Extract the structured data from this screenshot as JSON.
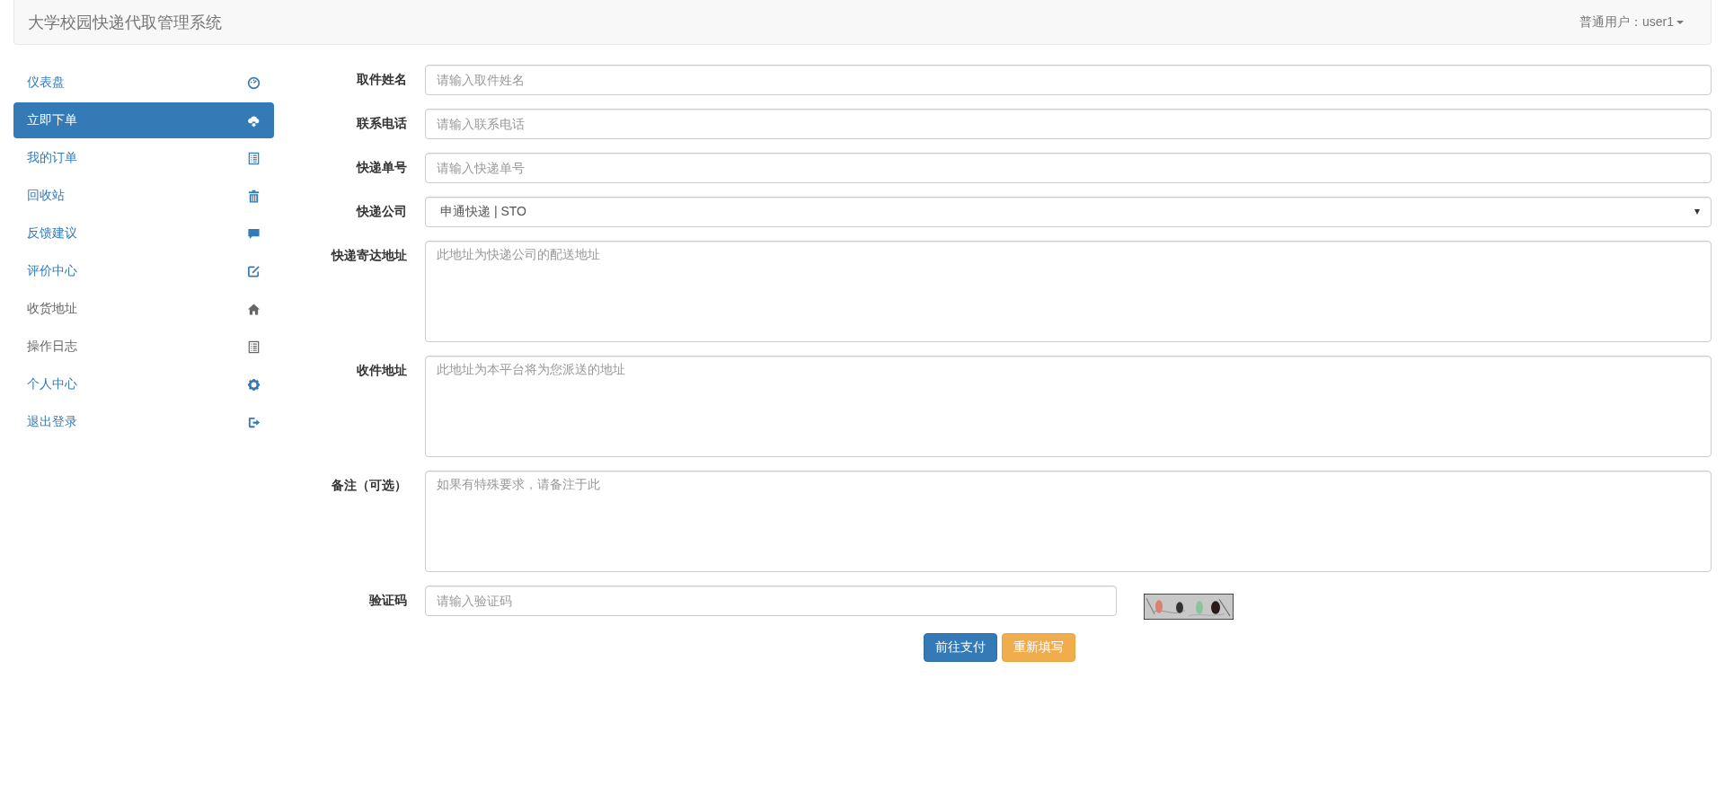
{
  "header": {
    "title": "大学校园快递代取管理系统",
    "user_menu": "普通用户：user1"
  },
  "sidebar": {
    "items": [
      {
        "label": "仪表盘",
        "kind": "gauge",
        "selected": false,
        "muted": false
      },
      {
        "label": "立即下单",
        "kind": "cloud",
        "selected": true,
        "muted": false
      },
      {
        "label": "我的订单",
        "kind": "list",
        "selected": false,
        "muted": false
      },
      {
        "label": "回收站",
        "kind": "trash",
        "selected": false,
        "muted": false
      },
      {
        "label": "反馈建议",
        "kind": "comment",
        "selected": false,
        "muted": false
      },
      {
        "label": "评价中心",
        "kind": "edit",
        "selected": false,
        "muted": false
      },
      {
        "label": "收货地址",
        "kind": "home",
        "selected": false,
        "muted": true
      },
      {
        "label": "操作日志",
        "kind": "list",
        "selected": false,
        "muted": true
      },
      {
        "label": "个人中心",
        "kind": "gear",
        "selected": false,
        "muted": false
      },
      {
        "label": "退出登录",
        "kind": "logout",
        "selected": false,
        "muted": false
      }
    ]
  },
  "form": {
    "fields": [
      {
        "label": "取件姓名",
        "kind": "input",
        "placeholder": "请输入取件姓名"
      },
      {
        "label": "联系电话",
        "kind": "input",
        "placeholder": "请输入联系电话"
      },
      {
        "label": "快递单号",
        "kind": "input",
        "placeholder": "请输入快递单号"
      },
      {
        "label": "快递公司",
        "kind": "select",
        "value": "申通快递 | STO"
      },
      {
        "label": "快递寄达地址",
        "kind": "textarea",
        "placeholder": "此地址为快递公司的配送地址"
      },
      {
        "label": "收件地址",
        "kind": "textarea",
        "placeholder": "此地址为本平台将为您派送的地址"
      },
      {
        "label": "备注（可选）",
        "kind": "textarea",
        "placeholder": "如果有特殊要求，请备注于此"
      },
      {
        "label": "验证码",
        "kind": "captcha",
        "placeholder": "请输入验证码"
      }
    ],
    "buttons": [
      {
        "label": "前往支付",
        "kind": "primary"
      },
      {
        "label": "重新填写",
        "kind": "warning"
      }
    ]
  }
}
